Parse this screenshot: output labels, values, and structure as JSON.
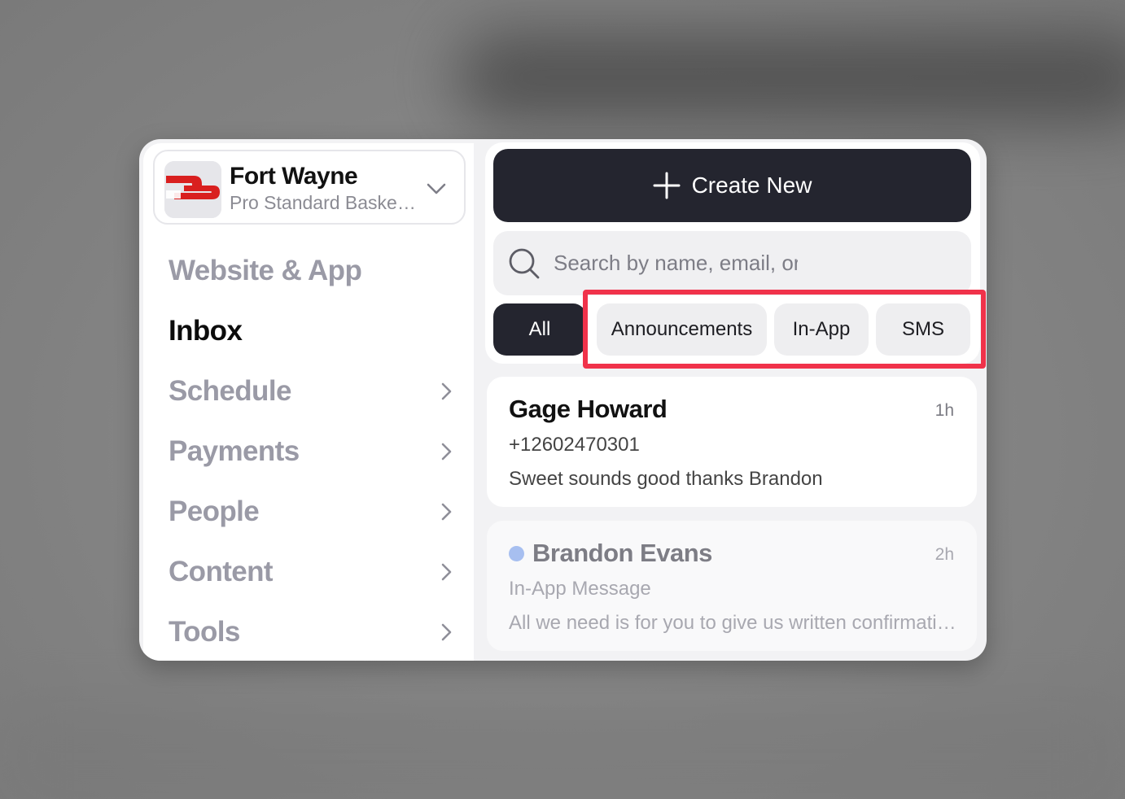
{
  "colors": {
    "accent_dark": "#24252f",
    "highlight": "#f0324a",
    "unread_dot": "#a7bff0",
    "nav_inactive": "#9a9aa6"
  },
  "org": {
    "name": "Fort Wayne",
    "subtitle": "Pro Standard Baske…",
    "logo_icon": "pro-standard-logo"
  },
  "nav": {
    "items": [
      {
        "label": "Website & App",
        "has_chevron": false,
        "active": false
      },
      {
        "label": "Inbox",
        "has_chevron": false,
        "active": true
      },
      {
        "label": "Schedule",
        "has_chevron": true,
        "active": false
      },
      {
        "label": "Payments",
        "has_chevron": true,
        "active": false
      },
      {
        "label": "People",
        "has_chevron": true,
        "active": false
      },
      {
        "label": "Content",
        "has_chevron": true,
        "active": false
      },
      {
        "label": "Tools",
        "has_chevron": true,
        "active": false
      }
    ]
  },
  "toolbar": {
    "create_label": "Create New",
    "search_placeholder": "Search by name, email, or"
  },
  "filters": {
    "selected": "All",
    "chips": [
      "All",
      "Announcements",
      "In-App",
      "SMS"
    ]
  },
  "messages": [
    {
      "name": "Gage Howard",
      "time": "1h",
      "subtitle": "+12602470301",
      "body": "Sweet sounds good thanks Brandon",
      "unread": false
    },
    {
      "name": "Brandon Evans",
      "time": "2h",
      "subtitle": "In-App Message",
      "body": "All we need is for you to give us written confirmation…",
      "unread": true
    }
  ]
}
